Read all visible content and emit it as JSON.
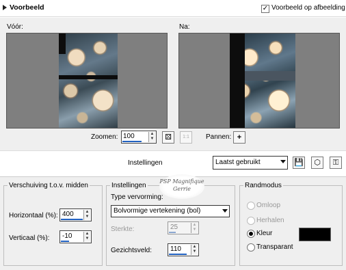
{
  "header": {
    "title": "Voorbeeld",
    "preview_on_image_label": "Voorbeeld op afbeelding",
    "preview_on_image_checked": true
  },
  "preview": {
    "before_label": "Vóór:",
    "after_label": "Na:"
  },
  "zoom": {
    "label": "Zoomen:",
    "value": "100",
    "actual_size_label": "1:1",
    "pan_label": "Pannen:"
  },
  "presets": {
    "label": "Instellingen",
    "selected": "Laatst gebruikt"
  },
  "shift_group": {
    "title": "Verschuiving t.o.v. midden",
    "horizontal_label": "Horizontaal (%):",
    "horizontal_value": "400",
    "vertical_label": "Verticaal (%):",
    "vertical_value": "-10"
  },
  "settings_group": {
    "title": "Instellingen",
    "distortion_type_label": "Type vervorming:",
    "distortion_type_value": "Bolvormige vertekening (bol)",
    "strength_label": "Sterkte:",
    "strength_value": "25",
    "fov_label": "Gezichtsveld:",
    "fov_value": "110"
  },
  "edge_group": {
    "title": "Randmodus",
    "options": [
      {
        "label": "Omloop",
        "selected": false,
        "enabled": false
      },
      {
        "label": "Herhalen",
        "selected": false,
        "enabled": false
      },
      {
        "label": "Kleur",
        "selected": true,
        "enabled": true
      },
      {
        "label": "Transparant",
        "selected": false,
        "enabled": true
      }
    ],
    "color_swatch": "#000000"
  },
  "watermark": {
    "line1": "PSP Magnifique",
    "line2": "Gerrie"
  }
}
